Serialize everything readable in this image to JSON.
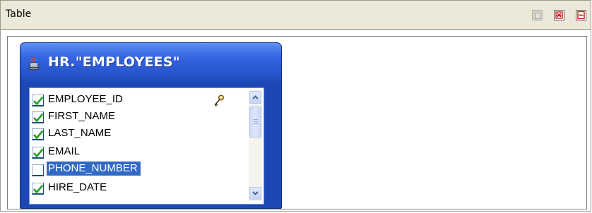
{
  "panel": {
    "title": "Table",
    "buttons": [
      {
        "name": "add",
        "enabled": false
      },
      {
        "name": "auto-layout",
        "enabled": true
      },
      {
        "name": "remove",
        "enabled": true
      }
    ]
  },
  "table_widget": {
    "title": "HR.\"EMPLOYEES\"",
    "icon": "table-icon",
    "columns": [
      {
        "name": "EMPLOYEE_ID",
        "checked": true,
        "primary_key": true,
        "selected": false
      },
      {
        "name": "FIRST_NAME",
        "checked": true,
        "primary_key": false,
        "selected": false
      },
      {
        "name": "LAST_NAME",
        "checked": true,
        "primary_key": false,
        "selected": false
      },
      {
        "name": "EMAIL",
        "checked": true,
        "primary_key": false,
        "selected": false
      },
      {
        "name": "PHONE_NUMBER",
        "checked": false,
        "primary_key": false,
        "selected": true
      },
      {
        "name": "HIRE_DATE",
        "checked": true,
        "primary_key": false,
        "selected": false
      }
    ]
  },
  "colors": {
    "header_bg": "#ece9d8",
    "titlebar": "#2a58d0",
    "selection": "#316ac5",
    "checkmark": "#21a121"
  }
}
